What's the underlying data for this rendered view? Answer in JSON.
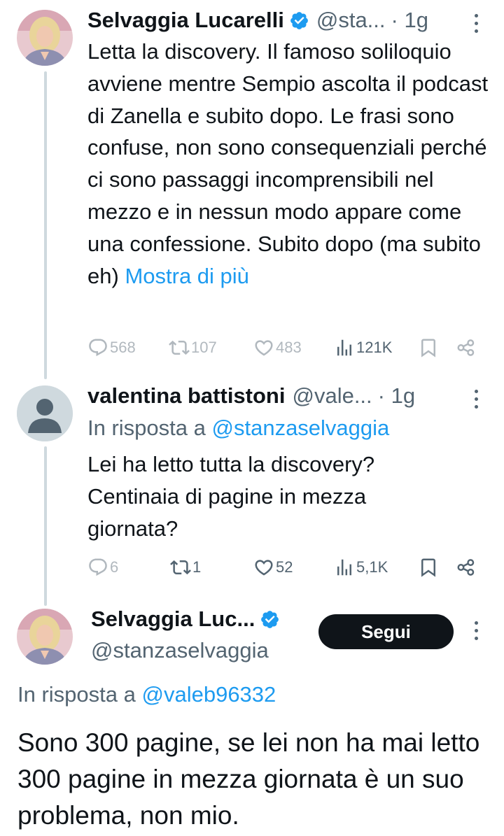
{
  "tweet1": {
    "author_name": "Selvaggia Lucarelli",
    "handle": "@sta...",
    "time": "· 1g",
    "text": "Letta la discovery. Il famoso soliloquio avviene mentre Sempio ascolta il podcast di Zanella e subito dopo. Le frasi sono confuse, non sono consequenziali perché ci sono passaggi incomprensibili nel mezzo e in nessun modo appare come una confessione. Subito dopo (ma subito eh)",
    "show_more": "Mostra di più",
    "replies": "568",
    "reposts": "107",
    "likes": "483",
    "views": "121K"
  },
  "tweet2": {
    "author_name": "valentina battistoni",
    "handle": "@vale...",
    "time": "· 1g",
    "reply_prefix": "In risposta a",
    "reply_handle": "@stanzaselvaggia",
    "text": "Lei ha letto tutta la discovery? Centinaia di pagine in mezza giornata?",
    "replies": "6",
    "reposts": "1",
    "likes": "52",
    "views": "5,1K"
  },
  "main_tweet": {
    "author_name": "Selvaggia Luc...",
    "handle": "@stanzaselvaggia",
    "follow_label": "Segui",
    "reply_prefix": "In risposta a",
    "reply_handle": "@valeb96332",
    "text": "Sono 300 pagine, se lei non ha mai letto 300 pagine in mezza giornata è un suo problema, non mio."
  },
  "colors": {
    "accent": "#1d9bf0",
    "text": "#0f1419",
    "muted": "#536471",
    "thread_line": "#cfd9de",
    "button_bg": "#0f1419"
  },
  "icons": [
    "verified-badge-icon",
    "more-icon",
    "reply-icon",
    "repost-icon",
    "like-icon",
    "views-icon",
    "bookmark-icon",
    "share-icon",
    "default-avatar-icon"
  ]
}
